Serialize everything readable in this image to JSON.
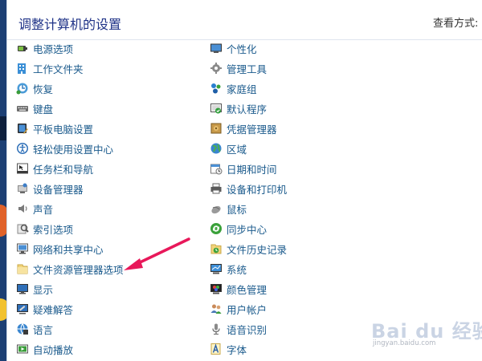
{
  "window": {
    "title": "调整计算机的设置",
    "view_by_label": "查看方式:"
  },
  "left_items": [
    {
      "label": "电源选项",
      "icon": "power-options-icon"
    },
    {
      "label": "工作文件夹",
      "icon": "work-folders-icon"
    },
    {
      "label": "恢复",
      "icon": "recovery-icon"
    },
    {
      "label": "键盘",
      "icon": "keyboard-icon"
    },
    {
      "label": "平板电脑设置",
      "icon": "tablet-settings-icon"
    },
    {
      "label": "轻松使用设置中心",
      "icon": "ease-of-access-icon"
    },
    {
      "label": "任务栏和导航",
      "icon": "taskbar-icon"
    },
    {
      "label": "设备管理器",
      "icon": "device-manager-icon"
    },
    {
      "label": "声音",
      "icon": "sound-icon"
    },
    {
      "label": "索引选项",
      "icon": "indexing-options-icon"
    },
    {
      "label": "网络和共享中心",
      "icon": "network-sharing-icon"
    },
    {
      "label": "文件资源管理器选项",
      "icon": "file-explorer-options-icon"
    },
    {
      "label": "显示",
      "icon": "display-icon"
    },
    {
      "label": "疑难解答",
      "icon": "troubleshooting-icon"
    },
    {
      "label": "语言",
      "icon": "language-icon"
    },
    {
      "label": "自动播放",
      "icon": "autoplay-icon"
    }
  ],
  "right_items": [
    {
      "label": "个性化",
      "icon": "personalization-icon"
    },
    {
      "label": "管理工具",
      "icon": "admin-tools-icon"
    },
    {
      "label": "家庭组",
      "icon": "homegroup-icon"
    },
    {
      "label": "默认程序",
      "icon": "default-programs-icon"
    },
    {
      "label": "凭据管理器",
      "icon": "credential-manager-icon"
    },
    {
      "label": "区域",
      "icon": "region-icon"
    },
    {
      "label": "日期和时间",
      "icon": "date-time-icon"
    },
    {
      "label": "设备和打印机",
      "icon": "devices-printers-icon"
    },
    {
      "label": "鼠标",
      "icon": "mouse-icon"
    },
    {
      "label": "同步中心",
      "icon": "sync-center-icon"
    },
    {
      "label": "文件历史记录",
      "icon": "file-history-icon"
    },
    {
      "label": "系统",
      "icon": "system-icon"
    },
    {
      "label": "颜色管理",
      "icon": "color-management-icon"
    },
    {
      "label": "用户帐户",
      "icon": "user-accounts-icon"
    },
    {
      "label": "语音识别",
      "icon": "speech-recognition-icon"
    },
    {
      "label": "字体",
      "icon": "fonts-icon"
    }
  ],
  "colors": {
    "title": "#1e3287",
    "link": "#1a5a8c",
    "annotation_arrow": "#e8185a"
  },
  "watermark": {
    "text": "Bai du 经验",
    "sub": "jingyan.baidu.com"
  }
}
